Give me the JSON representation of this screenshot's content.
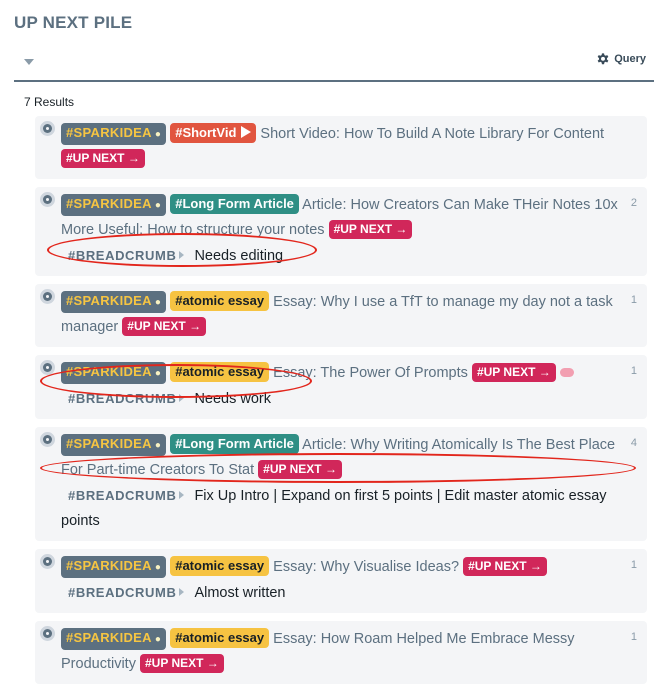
{
  "page": {
    "title": "UP NEXT PILE"
  },
  "toolbar": {
    "query_label": "Query"
  },
  "results_count": "7 Results",
  "tags": {
    "spark": "#SPARKIDEA",
    "short": "#ShortVid",
    "long": "#Long Form Article",
    "atomic": "#atomic essay",
    "upnext": "#UP NEXT",
    "upnext_arrow": "→",
    "breadcrumb": "#BREADCRUMB"
  },
  "icons": {
    "bullet": "bullet-icon",
    "bulb": "lightbulb-icon",
    "play": "play-icon",
    "brain": "brain-icon",
    "gear": "gear-icon",
    "caret": "caret-down-icon"
  },
  "colors": {
    "spark_bg": "#5c7080",
    "spark_text": "#f6c542",
    "short_bg": "#e1553f",
    "long_bg": "#2f8f85",
    "atomic_bg": "#f6c342",
    "upnext_bg": "#d1275a",
    "highlight_ellipse": "#e2261c"
  },
  "results": [
    {
      "title": "Short Video: How To Build A Note Library For Content",
      "refs": ""
    },
    {
      "title": "Article: How Creators Can Make THeir Notes 10x More Useful: How to structure your notes",
      "refs": "2",
      "breadcrumb": "Needs editing"
    },
    {
      "title": "Essay: Why I use a TfT to manage my day not a task manager",
      "refs": "1"
    },
    {
      "title": "Essay: The Power Of Prompts",
      "refs": "1",
      "breadcrumb": "Needs work"
    },
    {
      "title": "Article: Why Writing Atomically Is The Best Place For Part-time Creators To Stat",
      "refs": "4",
      "breadcrumb": "Fix Up Intro | Expand on first 5 points | Edit master atomic essay points"
    },
    {
      "title": "Essay: Why Visualise Ideas?",
      "refs": "1",
      "breadcrumb": "Almost written"
    },
    {
      "title": "Essay: How Roam Helped Me Embrace Messy Productivity",
      "refs": "1"
    }
  ]
}
